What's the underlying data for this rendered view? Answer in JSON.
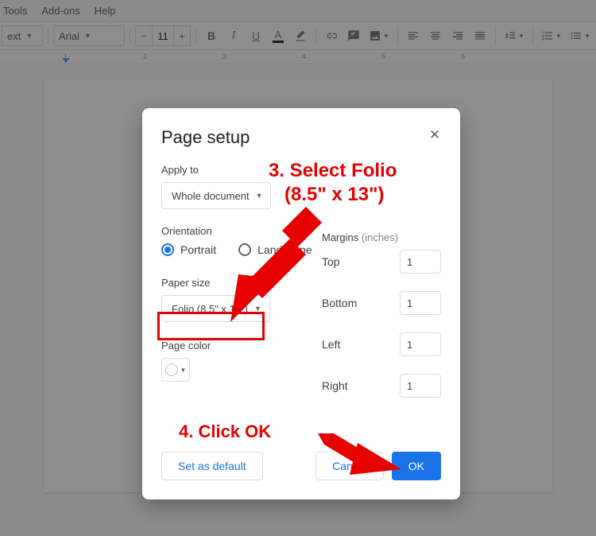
{
  "menu": {
    "tools": "Tools",
    "addons": "Add-ons",
    "help": "Help"
  },
  "toolbar": {
    "style": "ext",
    "font": "Arial",
    "size": "11"
  },
  "ruler_ticks": [
    "1",
    "2",
    "3",
    "4",
    "5",
    "6"
  ],
  "dialog": {
    "title": "Page setup",
    "apply_to_label": "Apply to",
    "apply_to_value": "Whole document",
    "orientation_label": "Orientation",
    "portrait": "Portrait",
    "landscape": "Landscape",
    "paper_size_label": "Paper size",
    "paper_size_value": "Folio (8.5\" x 13\")",
    "page_color_label": "Page color",
    "margins_label": "Margins",
    "margins_units": "(inches)",
    "top": "Top",
    "top_val": "1",
    "bottom": "Bottom",
    "bottom_val": "1",
    "left": "Left",
    "left_val": "1",
    "right": "Right",
    "right_val": "1",
    "set_default": "Set as default",
    "cancel": "Cancel",
    "ok": "OK"
  },
  "annotation": {
    "step3a": "3. Select Folio",
    "step3b": "(8.5\" x 13\")",
    "step4": "4. Click OK"
  }
}
